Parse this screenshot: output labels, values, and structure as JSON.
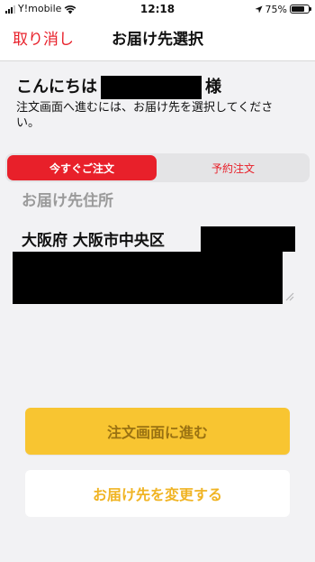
{
  "status_bar": {
    "carrier": "Y!mobile",
    "time": "12:18",
    "battery_percent": "75%",
    "battery_level": 0.75
  },
  "nav": {
    "cancel_label": "取り消し",
    "title": "お届け先選択"
  },
  "greeting": {
    "prefix": "こんにちは",
    "suffix": "様",
    "instruction": "注文画面へ進むには、お届け先を選択してください。"
  },
  "tabs": [
    {
      "label": "今すぐご注文",
      "selected": true
    },
    {
      "label": "予約注文",
      "selected": false
    }
  ],
  "address": {
    "section_label": "お届け先住所",
    "line1": "大阪府 大阪市中央区"
  },
  "buttons": {
    "proceed_label": "注文画面に進む",
    "change_label": "お届け先を変更する"
  },
  "colors": {
    "accent_red": "#e8202a",
    "primary_yellow": "#f8c531",
    "secondary_text_yellow": "#f0b424"
  },
  "icons": {
    "signal": "cellular-signal-icon",
    "wifi": "wifi-icon",
    "location": "location-arrow-icon",
    "battery": "battery-icon",
    "resize": "resize-handle-icon"
  }
}
